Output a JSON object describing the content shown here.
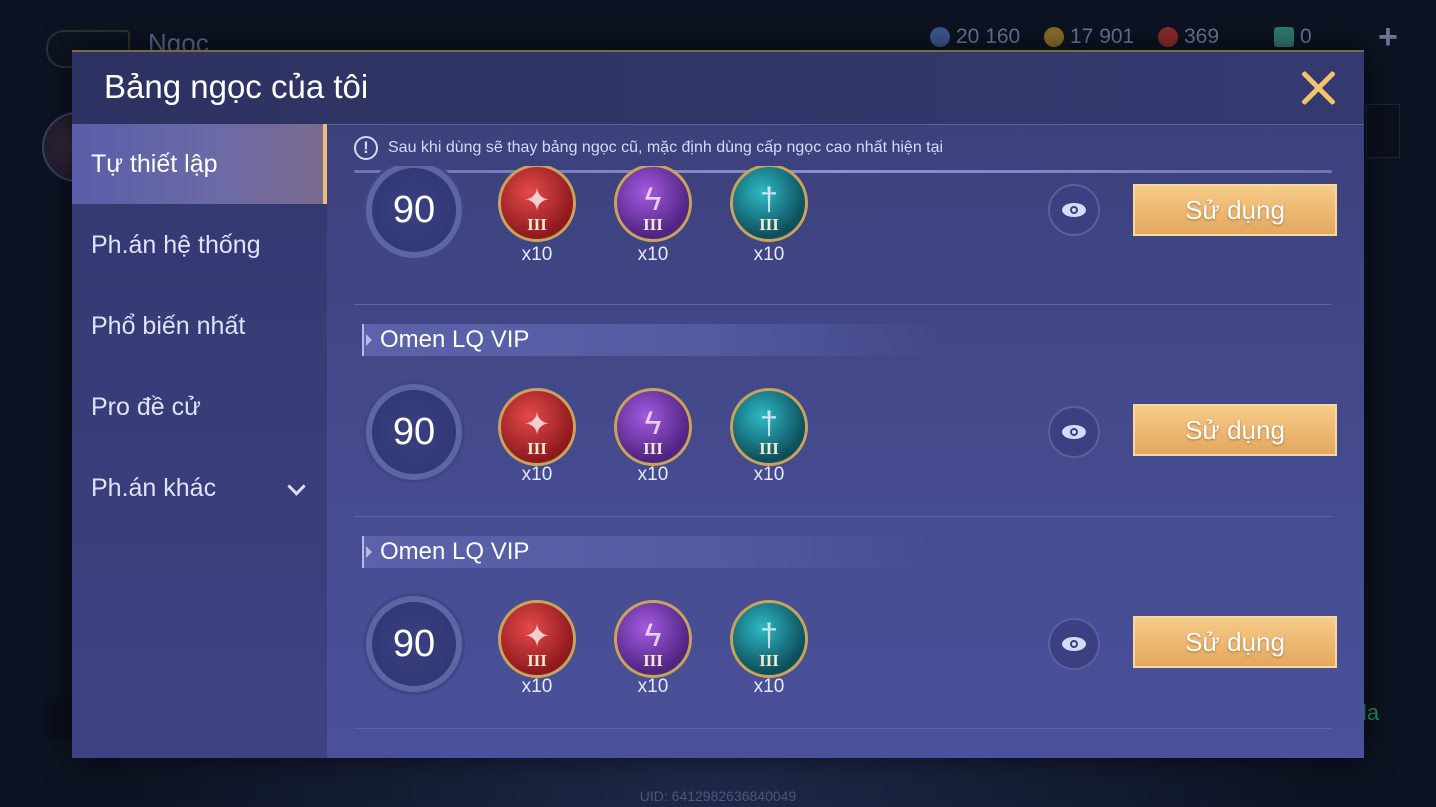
{
  "background": {
    "page_title": "Ngọc",
    "currencies": [
      {
        "icon": "blue-coin-icon",
        "value": "20 160",
        "color": "#4a6fb8"
      },
      {
        "icon": "gold-coin-icon",
        "value": "17 901",
        "color": "#b8902e"
      },
      {
        "icon": "red-gem-icon",
        "value": "369",
        "color": "#b8322e"
      },
      {
        "icon": "card-icon",
        "value": "0",
        "color": "#3fb8a0"
      }
    ],
    "add_label": "+",
    "uid": "UID: 6412982636840049",
    "right_partial_text": "la"
  },
  "dialog": {
    "title": "Bảng ngọc của tôi",
    "notice": "Sau khi dùng sẽ thay bảng ngọc cũ, mặc định dùng cấp ngọc cao nhất hiện tại",
    "notice_icon_text": "!"
  },
  "sidebar": {
    "items": [
      {
        "label": "Tự thiết lập",
        "active": true
      },
      {
        "label": "Ph.án hệ thống",
        "active": false
      },
      {
        "label": "Phổ biến nhất",
        "active": false
      },
      {
        "label": "Pro đề cử",
        "active": false
      },
      {
        "label": "Ph.án khác",
        "active": false,
        "has_dropdown": true
      }
    ]
  },
  "rune_pages": [
    {
      "name": "",
      "level": "90",
      "gems": [
        {
          "color": "red",
          "tier": "III",
          "count": "x10"
        },
        {
          "color": "purple",
          "tier": "III",
          "count": "x10"
        },
        {
          "color": "teal",
          "tier": "III",
          "count": "x10"
        }
      ],
      "use_label": "Sử dụng"
    },
    {
      "name": "Omen LQ VIP",
      "level": "90",
      "gems": [
        {
          "color": "red",
          "tier": "III",
          "count": "x10"
        },
        {
          "color": "purple",
          "tier": "III",
          "count": "x10"
        },
        {
          "color": "teal",
          "tier": "III",
          "count": "x10"
        }
      ],
      "use_label": "Sử dụng"
    },
    {
      "name": "Omen LQ VIP",
      "level": "90",
      "gems": [
        {
          "color": "red",
          "tier": "III",
          "count": "x10"
        },
        {
          "color": "purple",
          "tier": "III",
          "count": "x10"
        },
        {
          "color": "teal",
          "tier": "III",
          "count": "x10"
        }
      ],
      "use_label": "Sử dụng"
    }
  ],
  "colors": {
    "accent_gold": "#f3c46e",
    "button_gold": "#e4a75f",
    "panel": "#444a8c"
  }
}
